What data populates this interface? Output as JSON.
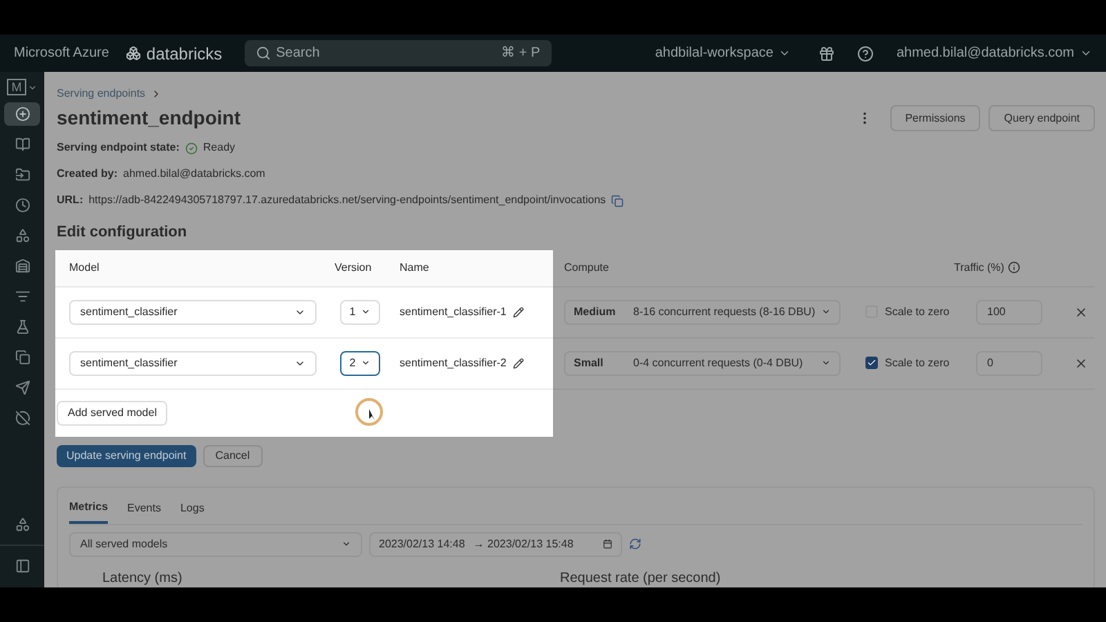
{
  "topbar": {
    "brand": "Microsoft Azure",
    "product": "databricks",
    "search": {
      "placeholder": "Search",
      "shortcut": "⌘ + P"
    },
    "workspace": "ahdbilal-workspace",
    "user": "ahmed.bilal@databricks.com"
  },
  "sidebar": {
    "workspace_letter": "M",
    "items": [
      {
        "selected": true
      },
      {
        "selected": false
      },
      {
        "selected": false
      },
      {
        "selected": false
      },
      {
        "selected": false
      },
      {
        "selected": false
      },
      {
        "selected": false
      },
      {
        "selected": false
      },
      {
        "selected": false
      },
      {
        "selected": false
      },
      {
        "selected": false
      }
    ]
  },
  "breadcrumb": "Serving endpoints",
  "title": "sentiment_endpoint",
  "actions": [
    "Permissions",
    "Query endpoint"
  ],
  "state": {
    "label": "Serving endpoint state:",
    "value": "Ready"
  },
  "created_by": {
    "label": "Created by:",
    "value": "ahmed.bilal@databricks.com"
  },
  "url": {
    "label": "URL:",
    "value": "https://adb-8422494305718797.17.azuredatabricks.net/serving-endpoints/sentiment_endpoint/invocations"
  },
  "section_title": "Edit configuration",
  "table": {
    "columns": [
      "Model",
      "Version",
      "Name",
      "Compute",
      "Traffic (%)"
    ],
    "rows": [
      {
        "model": "sentiment_classifier",
        "version": "1",
        "version_focused": false,
        "name": "sentiment_classifier-1",
        "size": "Medium",
        "compute": "8-16 concurrent requests (8-16 DBU)",
        "scale_label": "Scale to zero",
        "checked": false,
        "traffic": "100"
      },
      {
        "model": "sentiment_classifier",
        "version": "2",
        "version_focused": true,
        "name": "sentiment_classifier-2",
        "size": "Small",
        "compute": "0-4 concurrent requests (0-4 DBU)",
        "scale_label": "Scale to zero",
        "checked": true,
        "traffic": "0"
      }
    ]
  },
  "add_button": "Add served model",
  "update_button": "Update serving endpoint",
  "cancel_button": "Cancel",
  "metrics": {
    "tabs": [
      {
        "label": "Metrics",
        "selected": true
      },
      {
        "label": "Events",
        "selected": false
      },
      {
        "label": "Logs",
        "selected": false
      }
    ],
    "model_filter": "All served models",
    "start": "2023/02/13 14:48",
    "range_arrow": "→",
    "end": "2023/02/13 15:48",
    "chart_titles": [
      "Latency (ms)",
      "Request rate (per second)"
    ]
  }
}
